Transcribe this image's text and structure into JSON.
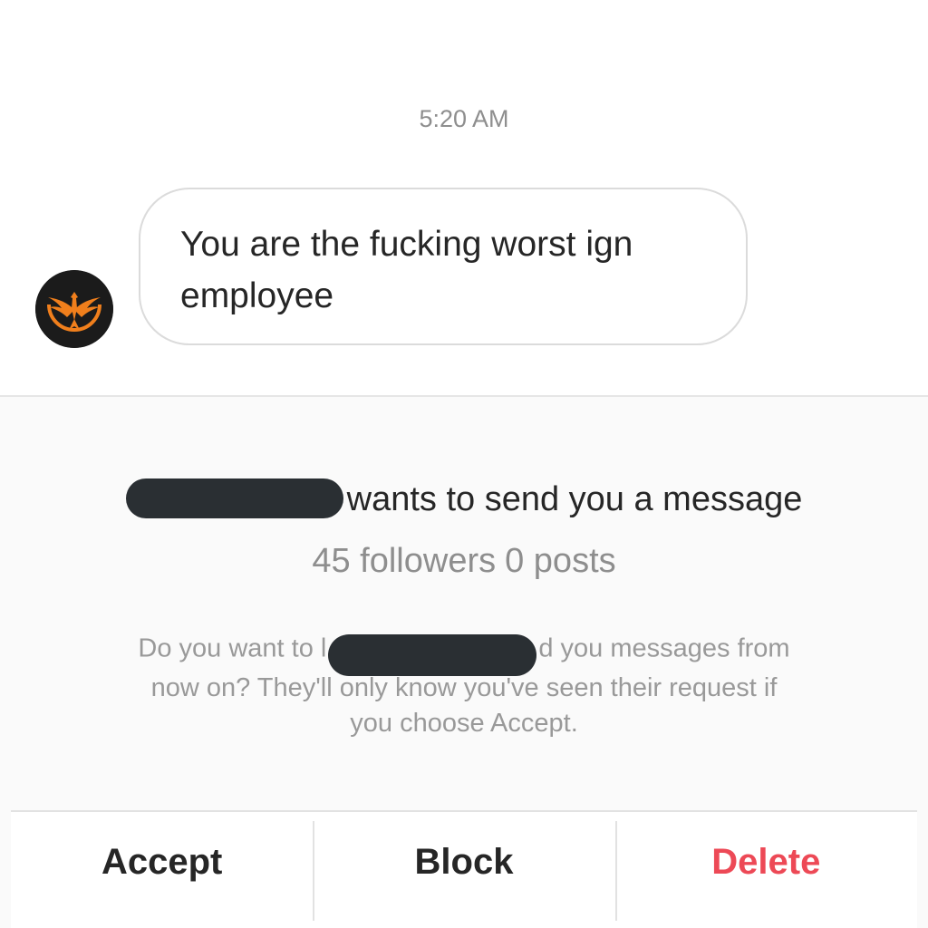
{
  "conversation": {
    "timestamp": "5:20 AM",
    "message": {
      "line1": "You are the fucking worst ign",
      "line2": "employee"
    },
    "sender_avatar": {
      "icon": "phoenix-emblem-icon",
      "colors": {
        "background": "#1b1b1b",
        "emblem": "#f07f1c"
      }
    }
  },
  "request": {
    "title_suffix": "wants to send you a message",
    "followers": "45 followers",
    "posts": "0 posts",
    "description": {
      "before_redaction": "Do you want to l",
      "after_redaction": "d you messages from",
      "line2": "now on? They'll only know you've seen their request if",
      "line3": "you choose Accept."
    }
  },
  "actions": {
    "accept_label": "Accept",
    "block_label": "Block",
    "delete_label": "Delete",
    "delete_color": "#ed4956"
  }
}
